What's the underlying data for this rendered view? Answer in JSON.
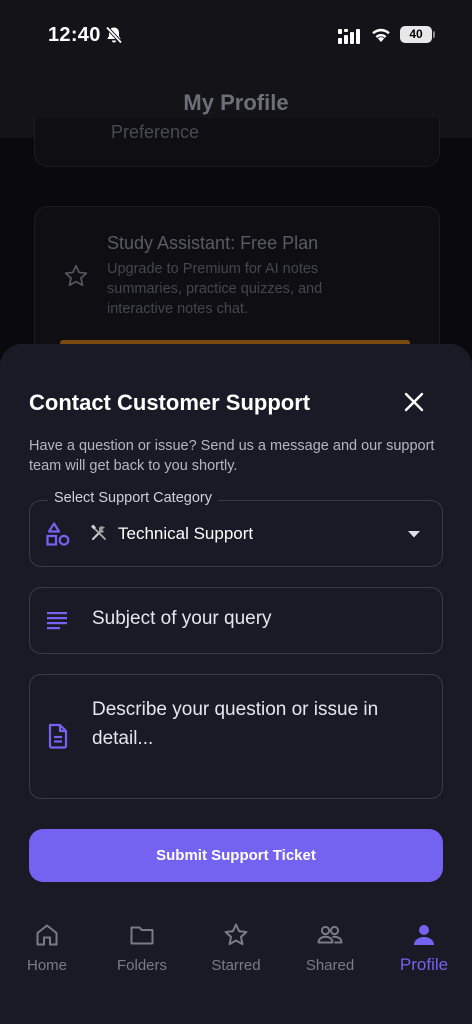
{
  "status_bar": {
    "time": "12:40",
    "battery": "40"
  },
  "header": {
    "title": "My Profile"
  },
  "background": {
    "preference_label": "Preference",
    "plan_card": {
      "title": "Study Assistant: Free Plan",
      "description": "Upgrade to Premium for AI notes summaries, practice quizzes, and interactive notes chat."
    }
  },
  "sheet": {
    "title": "Contact Customer Support",
    "description": "Have a question or issue? Send us a message and our support team will get back to you shortly.",
    "category": {
      "label": "Select Support Category",
      "icon": "shapes-icon",
      "value_icon": "tools-icon",
      "selected": "Technical Support"
    },
    "subject": {
      "placeholder": "Subject of your query",
      "icon": "lines-icon"
    },
    "details": {
      "placeholder": "Describe your question or issue in detail...",
      "icon": "document-icon"
    },
    "submit_label": "Submit Support Ticket",
    "accent_color": "#7462f0"
  },
  "nav": {
    "items": [
      {
        "label": "Home",
        "icon": "home-icon"
      },
      {
        "label": "Folders",
        "icon": "folder-icon"
      },
      {
        "label": "Starred",
        "icon": "star-icon"
      },
      {
        "label": "Shared",
        "icon": "people-icon"
      },
      {
        "label": "Profile",
        "icon": "person-icon",
        "active": true
      }
    ]
  }
}
